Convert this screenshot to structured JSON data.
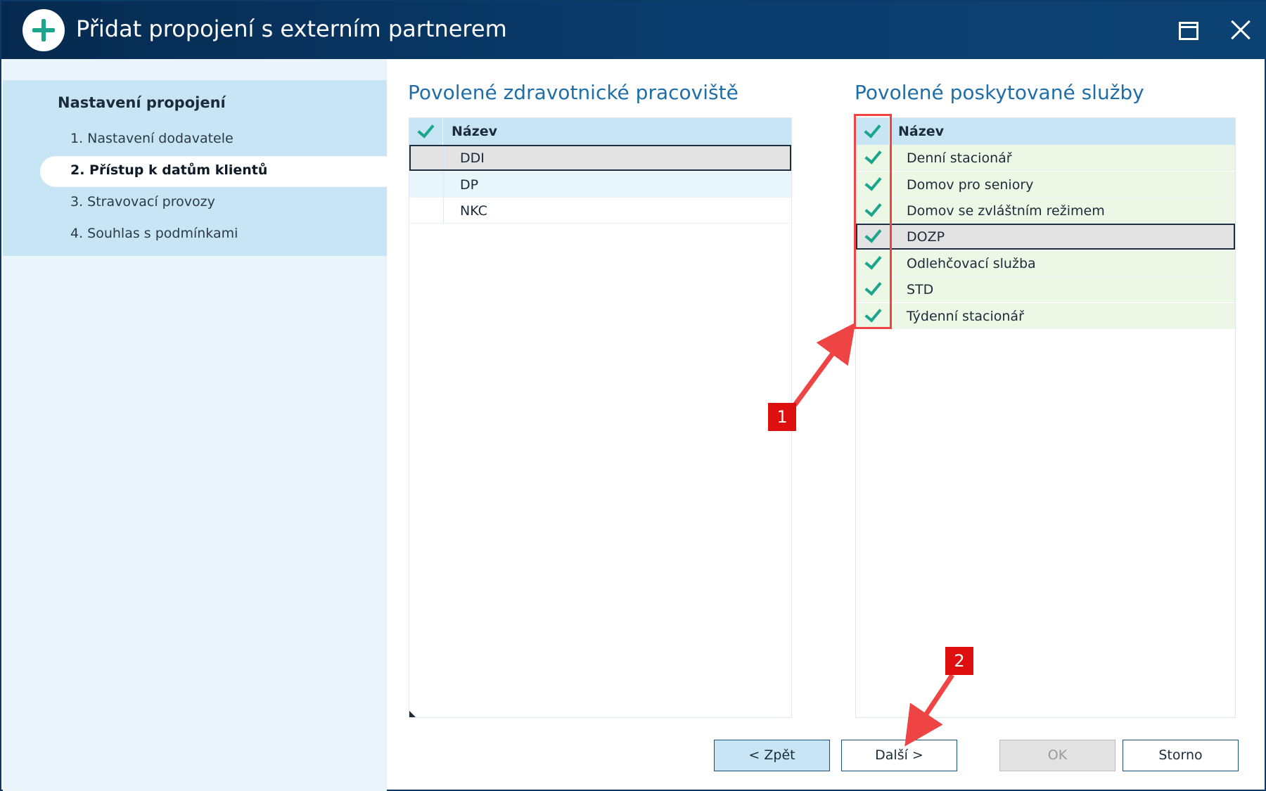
{
  "window": {
    "title": "Přidat propojení s externím partnerem",
    "title_icon": "plus-circle-icon",
    "maximize_icon": "maximize-icon",
    "close_icon": "close-icon"
  },
  "sidebar": {
    "title": "Nastavení propojení",
    "steps": [
      {
        "label": "1. Nastavení dodavatele"
      },
      {
        "label": "2. Přístup k datům klientů",
        "active": true
      },
      {
        "label": "3. Stravovací provozy"
      },
      {
        "label": "4. Souhlas s podmínkami"
      }
    ]
  },
  "workplaces": {
    "title": "Povolené zdravotnické pracoviště",
    "column": "Název",
    "rows": [
      {
        "name": "DDI",
        "checked": false,
        "selected": true
      },
      {
        "name": "DP",
        "checked": false
      },
      {
        "name": "NKC",
        "checked": false
      }
    ]
  },
  "services": {
    "title": "Povolené poskytované služby",
    "column": "Název",
    "rows": [
      {
        "name": "Denní stacionář",
        "checked": true
      },
      {
        "name": "Domov pro seniory",
        "checked": true
      },
      {
        "name": "Domov se zvláštním režimem",
        "checked": true
      },
      {
        "name": "DOZP",
        "checked": true,
        "selected": true
      },
      {
        "name": "Odlehčovací služba",
        "checked": true
      },
      {
        "name": "STD",
        "checked": true
      },
      {
        "name": "Týdenní stacionář",
        "checked": true
      }
    ]
  },
  "buttons": {
    "back": "< Zpět",
    "next": "Další >",
    "ok": "OK",
    "cancel": "Storno"
  },
  "annotations": {
    "badge1": "1",
    "badge2": "2"
  },
  "colors": {
    "title_bar": "#062a4f",
    "accent_check": "#1aa58c",
    "section_title": "#1f6ea8",
    "annotation": "#ef4444"
  }
}
